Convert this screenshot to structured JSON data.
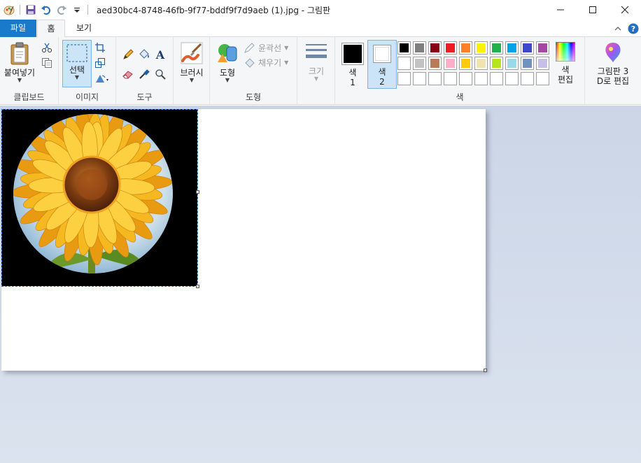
{
  "window": {
    "title": "aed30bc4-8748-46fb-9f77-bddf9f7d9aeb (1).jpg - 그림판"
  },
  "tabs": {
    "file": "파일",
    "home": "홈",
    "view": "보기"
  },
  "clipboard": {
    "paste": "붙여넣기",
    "group": "클립보드"
  },
  "image": {
    "select": "선택",
    "group": "이미지"
  },
  "tools": {
    "group": "도구"
  },
  "brushes": {
    "label": "브러시"
  },
  "shapes": {
    "label": "도형",
    "outline": "윤곽선",
    "fill": "채우기",
    "group": "도형"
  },
  "size": {
    "label": "크기"
  },
  "colors": {
    "color1_line1": "색",
    "color1_line2": "1",
    "color2_line1": "색",
    "color2_line2": "2",
    "edit_line1": "색",
    "edit_line2": "편집",
    "group": "색",
    "color1_value": "#000000",
    "color2_value": "#ffffff",
    "palette": [
      [
        "#000000",
        "#7f7f7f",
        "#880015",
        "#ed1c24",
        "#ff7f27",
        "#fff200",
        "#22b14c",
        "#00a2e8",
        "#3f48cc",
        "#a349a4"
      ],
      [
        "#ffffff",
        "#c3c3c3",
        "#b97a57",
        "#ffaec9",
        "#ffc90e",
        "#efe4b0",
        "#b5e61d",
        "#99d9ea",
        "#7092be",
        "#c8bfe7"
      ],
      [
        "#ffffff",
        "#ffffff",
        "#ffffff",
        "#ffffff",
        "#ffffff",
        "#ffffff",
        "#ffffff",
        "#ffffff",
        "#ffffff",
        "#ffffff"
      ]
    ]
  },
  "paint3d": {
    "line1": "그림판 3",
    "line2": "D로 편집"
  }
}
